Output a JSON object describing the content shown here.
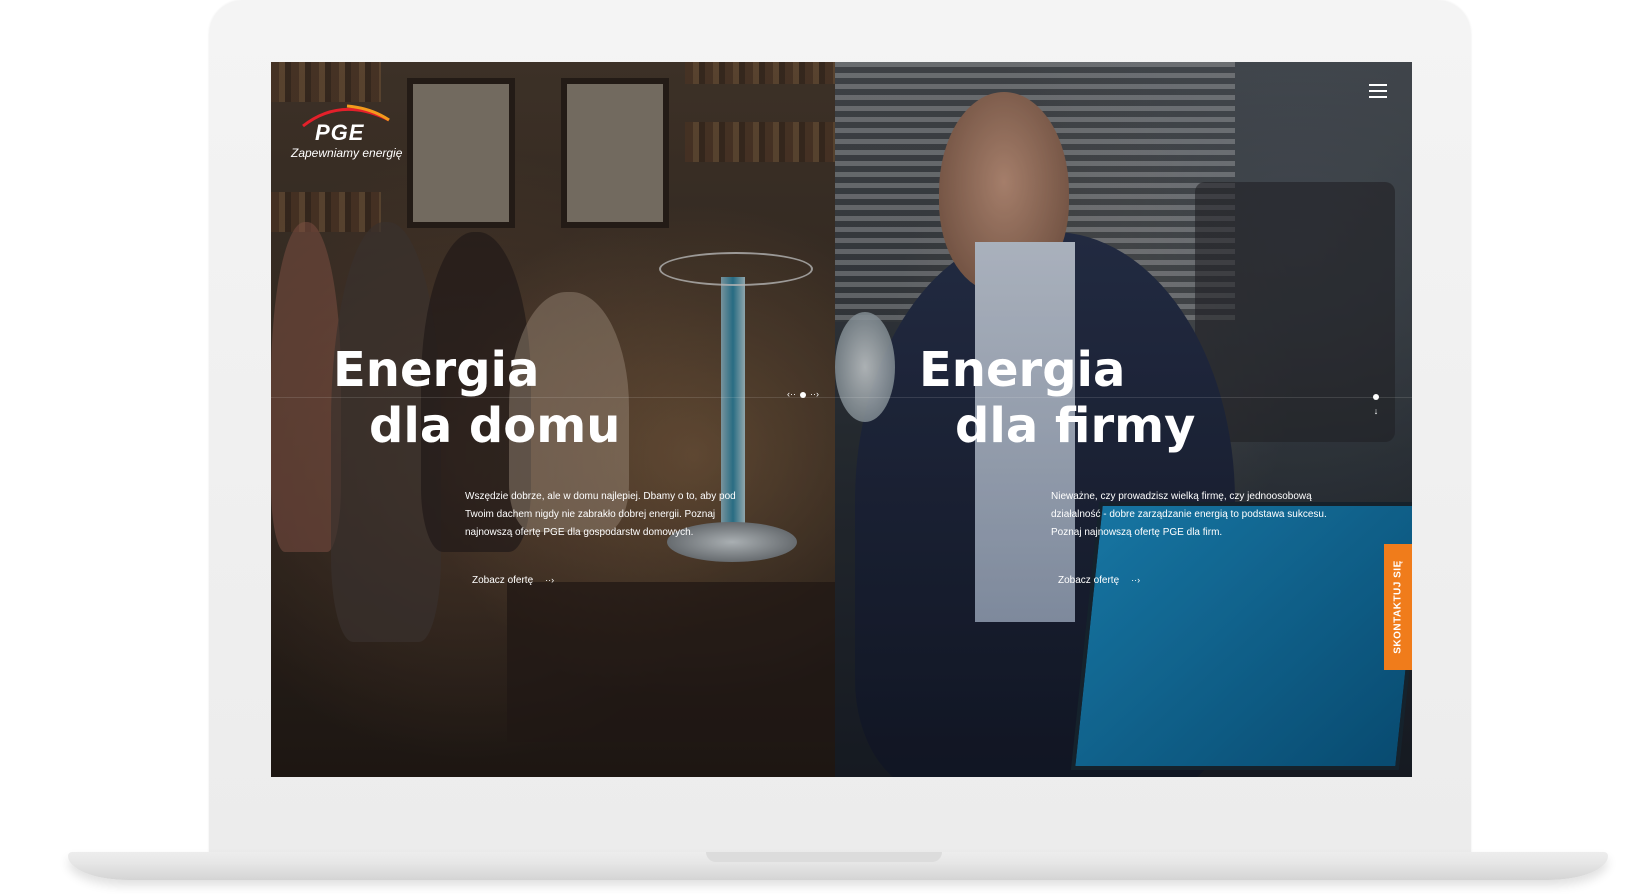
{
  "brand": {
    "logo_text": "PGE",
    "tagline": "Zapewniamy energię",
    "accent_color": "#f07c1b",
    "arc_colors": [
      "#e4202a",
      "#f39a1c"
    ]
  },
  "nav": {
    "menu_icon": "hamburger-icon",
    "center_prev": "‹··",
    "center_next": "··›",
    "side_arrow": "↓"
  },
  "home": {
    "title_line1": "Energia",
    "title_line2": "dla domu",
    "description": "Wszędzie dobrze, ale w domu najlepiej. Dbamy o to, aby pod Twoim dachem nigdy nie zabrakło dobrej energii. Poznaj najnowszą ofertę PGE dla gospodarstw domowych.",
    "cta": "Zobacz ofertę",
    "cta_icon": "arrow-right-icon"
  },
  "business": {
    "title_line1": "Energia",
    "title_line2": "dla firmy",
    "description": "Nieważne, czy prowadzisz wielką firmę, czy jednoosobową działalność - dobre zarządzanie energią to podstawa sukcesu. Poznaj najnowszą ofertę PGE dla firm.",
    "cta": "Zobacz ofertę",
    "cta_icon": "arrow-right-icon"
  },
  "contact": {
    "label": "SKONTAKTUJ SIĘ"
  }
}
